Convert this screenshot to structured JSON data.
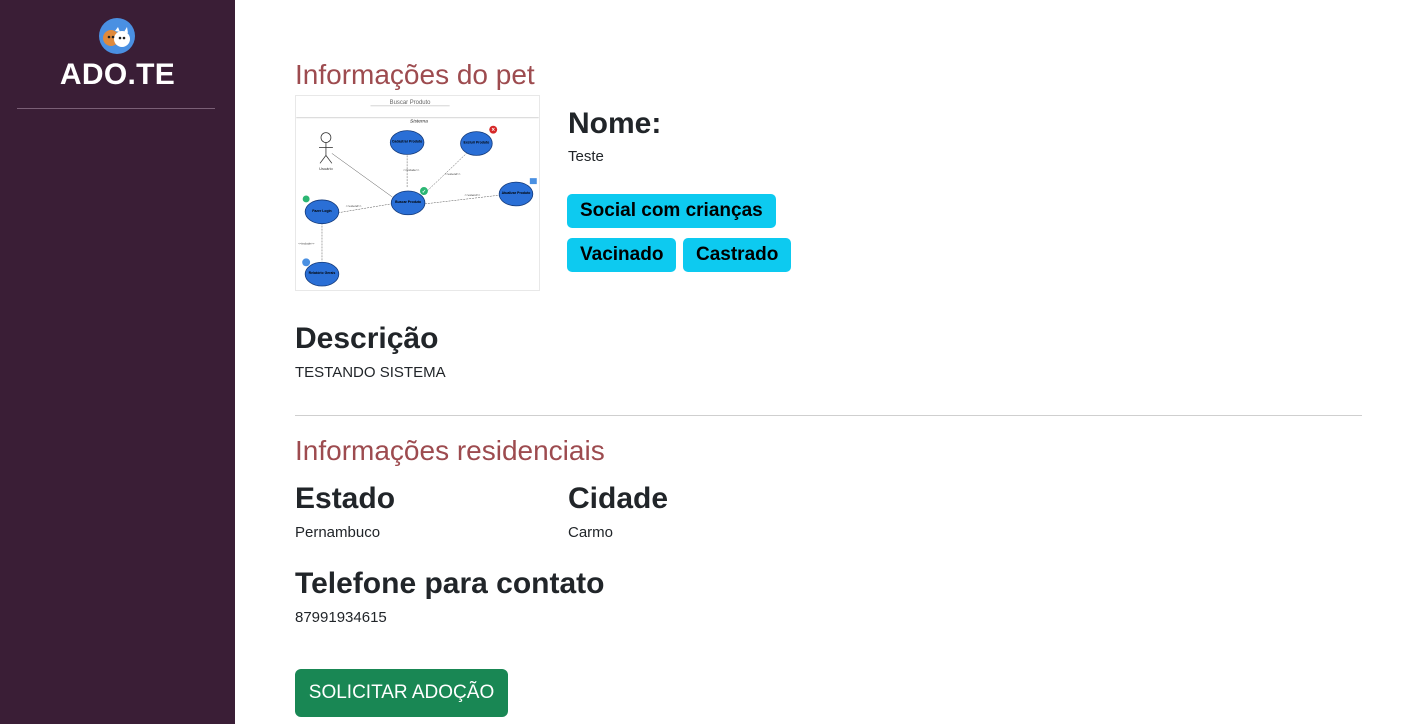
{
  "sidebar": {
    "brand": "ADO.TE",
    "logo_icon": "pets-logo-icon"
  },
  "pet": {
    "section_title": "Informações do pet",
    "image_icon": "use-case-diagram-image",
    "name_label": "Nome:",
    "name_value": "Teste",
    "tags": [
      "Social com crianças",
      "Vacinado",
      "Castrado"
    ],
    "tag_color": "#0dcaf0",
    "description_label": "Descrição",
    "description_value": "TESTANDO SISTEMA",
    "diagram": {
      "title": "Buscar Produto",
      "subtitle": "Sistema",
      "actor": "Usuário",
      "nodes": [
        "Cadastrar Produto",
        "Excluir Produto",
        "Buscar Produto",
        "Fazer Login",
        "Atualizar Produto",
        "Relatório Gerais"
      ],
      "edges": [
        "<<include>>",
        "<<extend>>",
        "<<extend>>",
        "<<extend>>",
        "<<include>>"
      ]
    }
  },
  "residence": {
    "section_title": "Informações residenciais",
    "state_label": "Estado",
    "state_value": "Pernambuco",
    "city_label": "Cidade",
    "city_value": "Carmo",
    "phone_label": "Telefone para contato",
    "phone_value": "87991934615"
  },
  "actions": {
    "request_button": "SOLICITAR ADOÇÃO",
    "button_color": "#198754"
  },
  "colors": {
    "sidebar": "#3a1e36",
    "section_title": "#9d4b4f"
  }
}
